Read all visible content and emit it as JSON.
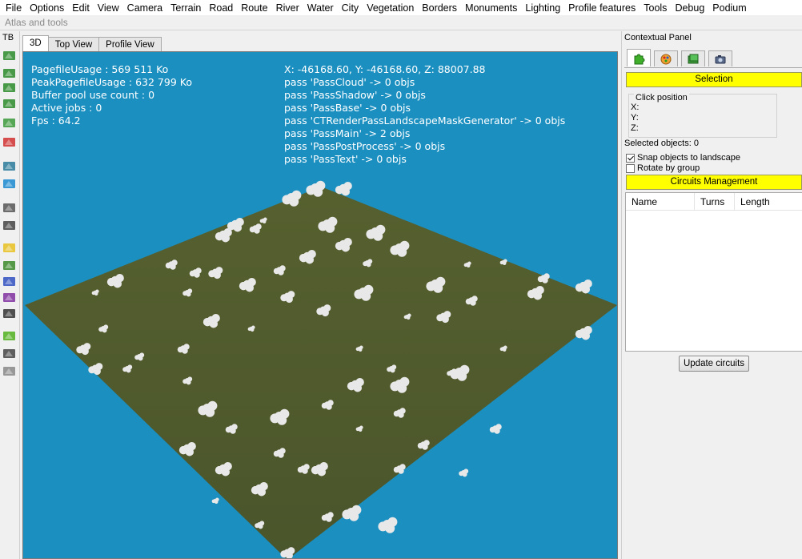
{
  "menubar": {
    "items": [
      "File",
      "Options",
      "Edit",
      "View",
      "Camera",
      "Terrain",
      "Road",
      "Route",
      "River",
      "Water",
      "City",
      "Vegetation",
      "Borders",
      "Monuments",
      "Lighting",
      "Profile features",
      "Tools",
      "Debug",
      "Podium"
    ]
  },
  "subbar": {
    "label": "Atlas and tools"
  },
  "toolbar": {
    "label": "TB",
    "icons": [
      "terrain-raise-icon",
      "terrain-smooth-icon",
      "terrain-lower-icon",
      "terrain-flatten-icon",
      "road-icon",
      "route-icon",
      "map-icon",
      "water-globe-icon",
      "city-grid-icon",
      "buildings-icon",
      "zone-icon",
      "tree-icon",
      "teapot-icon",
      "path-icon",
      "house-icon",
      "lightning-icon",
      "fence-icon",
      "misc-icon"
    ]
  },
  "view_tabs": [
    {
      "label": "3D",
      "active": true
    },
    {
      "label": "Top View",
      "active": false
    },
    {
      "label": "Profile View",
      "active": false
    }
  ],
  "hud": {
    "left": [
      "PagefileUsage : 569 511 Ko",
      "PeakPagefileUsage : 632 799 Ko",
      "Buffer pool use count : 0",
      "Active jobs : 0",
      "Fps : 64.2"
    ],
    "right": [
      "X: -46168.60, Y: -46168.60, Z: 88007.88",
      "pass 'PassCloud' -> 0 objs",
      "pass 'PassShadow' -> 0 objs",
      "pass 'PassBase' -> 0 objs",
      "pass 'CTRenderPassLandscapeMaskGenerator' -> 0 objs",
      "pass 'PassMain' -> 2 objs",
      "pass 'PassPostProcess' -> 0 objs",
      "pass 'PassText' -> 0 objs"
    ]
  },
  "viewport_colors": {
    "sky": "#1b8fc0",
    "terrain": "#4f5a2c"
  },
  "contextual_panel": {
    "title": "Contextual Panel",
    "tabs": [
      "puzzle-icon",
      "palette-icon",
      "layer-icon",
      "camera-icon"
    ],
    "selection_button": "Selection",
    "click_position": {
      "label": "Click position",
      "x_label": "X:",
      "y_label": "Y:",
      "z_label": "Z:"
    },
    "selected_objects": "Selected objects: 0",
    "snap_label": "Snap objects to landscape",
    "snap_checked": true,
    "rotate_label": "Rotate by group",
    "rotate_checked": false,
    "circuits_button": "Circuits Management",
    "table_headers": [
      "Name",
      "Turns",
      "Length"
    ],
    "update_button": "Update circuits"
  }
}
